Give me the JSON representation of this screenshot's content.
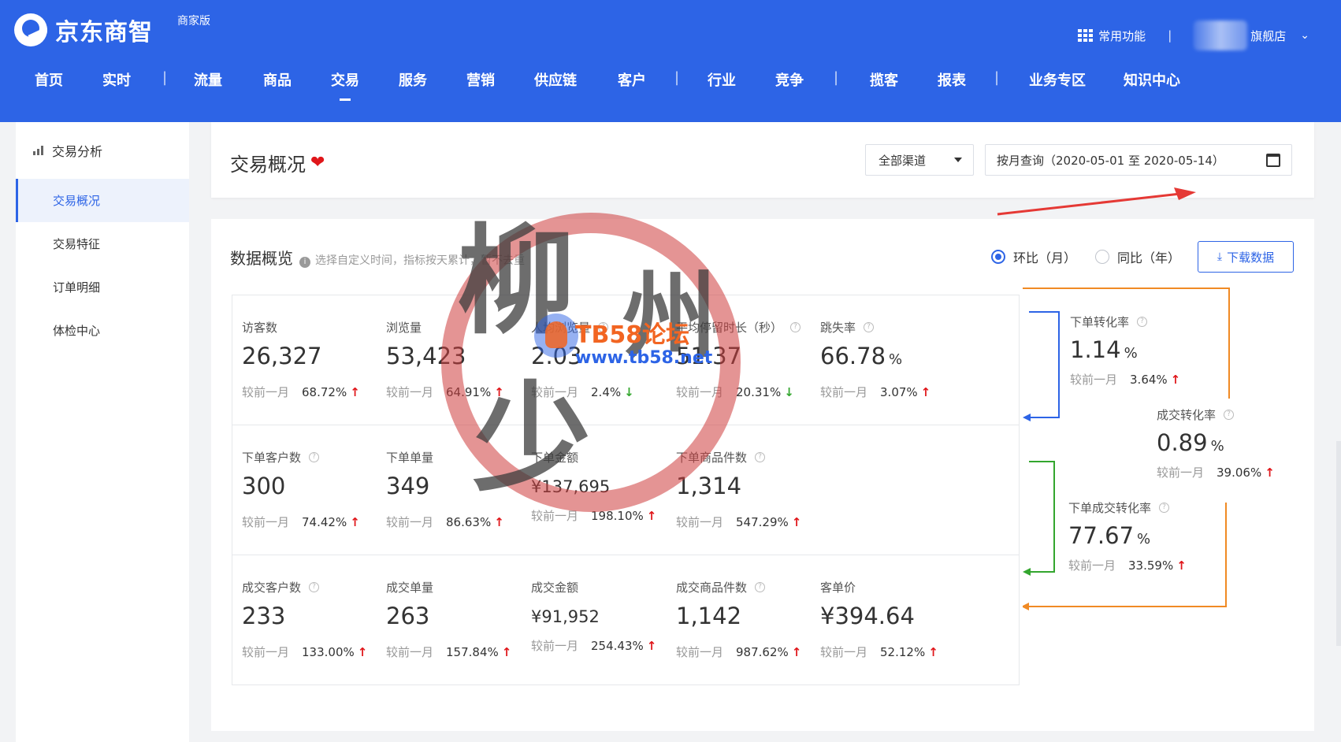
{
  "header": {
    "logo_text": "京东商智",
    "logo_sub": "商家版",
    "common_functions": "常用功能",
    "separator": "|",
    "store_suffix": "旗舰店"
  },
  "nav": [
    "首页",
    "实时",
    "|",
    "流量",
    "商品",
    "交易",
    "服务",
    "营销",
    "供应链",
    "客户",
    "|",
    "行业",
    "竞争",
    "|",
    "揽客",
    "报表",
    "|",
    "业务专区",
    "知识中心"
  ],
  "nav_active": "交易",
  "sidebar": {
    "title": "交易分析",
    "items": [
      "交易概况",
      "交易特征",
      "订单明细",
      "体检中心"
    ],
    "active": "交易概况"
  },
  "title_card": {
    "title": "交易概况",
    "channel": "全部渠道",
    "date_range": "按月查询（2020-05-01 至 2020-05-14）",
    "heart_color": "#e0161a"
  },
  "overview": {
    "title": "数据概览",
    "hint": "选择自定义时间，指标按天累计，暂不去重",
    "radio_mom": "环比（月）",
    "radio_yoy": "同比（年）",
    "download": "下载数据",
    "compare_label": "较前一月",
    "rows": [
      [
        {
          "label": "访客数",
          "value": "26,327",
          "unit": "",
          "cmp": "68.72%",
          "trend": "up",
          "help": false
        },
        {
          "label": "浏览量",
          "value": "53,423",
          "unit": "",
          "cmp": "64.91%",
          "trend": "up",
          "help": false
        },
        {
          "label": "人均浏览量",
          "value": "2.03",
          "unit": "",
          "cmp": "2.4%",
          "trend": "down",
          "help": true
        },
        {
          "label": "平均停留时长（秒）",
          "value": "51.37",
          "unit": "",
          "cmp": "20.31%",
          "trend": "down",
          "help": true
        },
        {
          "label": "跳失率",
          "value": "66.78",
          "unit": "%",
          "cmp": "3.07%",
          "trend": "up",
          "help": true
        }
      ],
      [
        {
          "label": "下单客户数",
          "value": "300",
          "unit": "",
          "cmp": "74.42%",
          "trend": "up",
          "help": true
        },
        {
          "label": "下单单量",
          "value": "349",
          "unit": "",
          "cmp": "86.63%",
          "trend": "up",
          "help": false
        },
        {
          "label": "下单金额",
          "value": "¥137,695",
          "unit": "",
          "cmp": "198.10%",
          "trend": "up",
          "help": false,
          "small": true
        },
        {
          "label": "下单商品件数",
          "value": "1,314",
          "unit": "",
          "cmp": "547.29%",
          "trend": "up",
          "help": true
        }
      ],
      [
        {
          "label": "成交客户数",
          "value": "233",
          "unit": "",
          "cmp": "133.00%",
          "trend": "up",
          "help": true
        },
        {
          "label": "成交单量",
          "value": "263",
          "unit": "",
          "cmp": "157.84%",
          "trend": "up",
          "help": false
        },
        {
          "label": "成交金额",
          "value": "¥91,952",
          "unit": "",
          "cmp": "254.43%",
          "trend": "up",
          "help": false,
          "small": true
        },
        {
          "label": "成交商品件数",
          "value": "1,142",
          "unit": "",
          "cmp": "987.62%",
          "trend": "up",
          "help": true
        },
        {
          "label": "客单价",
          "value": "¥394.64",
          "unit": "",
          "cmp": "52.12%",
          "trend": "up",
          "help": false
        }
      ]
    ],
    "funnel": [
      {
        "label": "下单转化率",
        "value": "1.14",
        "unit": "%",
        "cmp": "3.64%",
        "trend": "up"
      },
      {
        "label": "成交转化率",
        "value": "0.89",
        "unit": "%",
        "cmp": "39.06%",
        "trend": "up"
      },
      {
        "label": "下单成交转化率",
        "value": "77.67",
        "unit": "%",
        "cmp": "33.59%",
        "trend": "up"
      }
    ]
  },
  "watermark": {
    "chars": [
      "柳",
      "州",
      "少"
    ],
    "site": "TB58论坛",
    "url": "www.tb58.net"
  },
  "colors": {
    "brand": "#2d64e6",
    "up": "#e0161a",
    "down": "#33a62e",
    "funnel_blue": "#2d64e6",
    "funnel_orange": "#f08a24",
    "funnel_green": "#33a62e"
  }
}
